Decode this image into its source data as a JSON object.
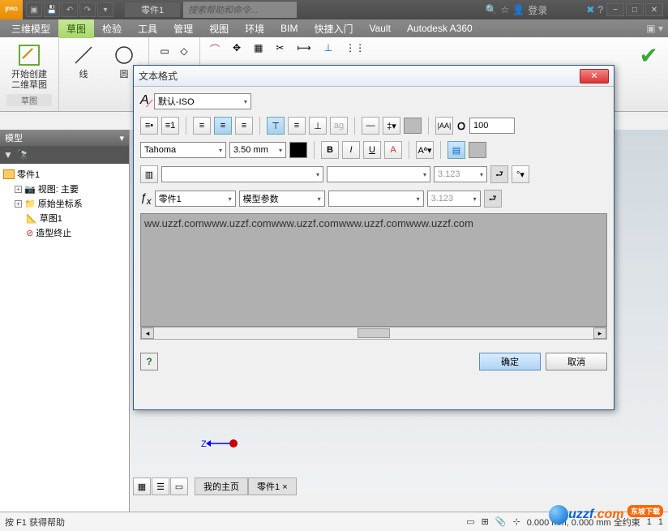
{
  "titlebar": {
    "pro": "PRO",
    "doc": "零件1",
    "search_placeholder": "搜索帮助和命令...",
    "login": "登录"
  },
  "tabs": [
    "三维模型",
    "草图",
    "检验",
    "工具",
    "管理",
    "视图",
    "环境",
    "BIM",
    "快捷入门",
    "Vault",
    "Autodesk A360"
  ],
  "ribbon": {
    "sketch_btn": "开始创建\n二维草图",
    "line": "线",
    "circle": "圆",
    "group1": "草图"
  },
  "browser": {
    "header": "模型",
    "root": "零件1",
    "view": "视图: 主要",
    "origin": "原始坐标系",
    "sketch": "草图1",
    "end": "造型终止"
  },
  "dialog": {
    "title": "文本格式",
    "style": "默认-ISO",
    "font": "Tahoma",
    "size": "3.50 mm",
    "stretch": "100",
    "param_source": "零件1",
    "param_type": "模型参数",
    "precision1": "3.123",
    "precision2": "3.123",
    "text": "ww.uzzf.comwww.uzzf.comwww.uzzf.comwww.uzzf.comwww.uzzf.com",
    "ok": "确定",
    "cancel": "取消"
  },
  "tabs_bottom": {
    "home": "我的主页",
    "doc": "零件1"
  },
  "status": {
    "help": "按 F1 获得帮助",
    "coords": "0.000 mm, 0.000 mm 全约束",
    "count": "1",
    "one": "1"
  },
  "axis": "Z",
  "logo": {
    "text": "uzzf",
    "dom": ".com",
    "bubble": "东坡下载"
  }
}
